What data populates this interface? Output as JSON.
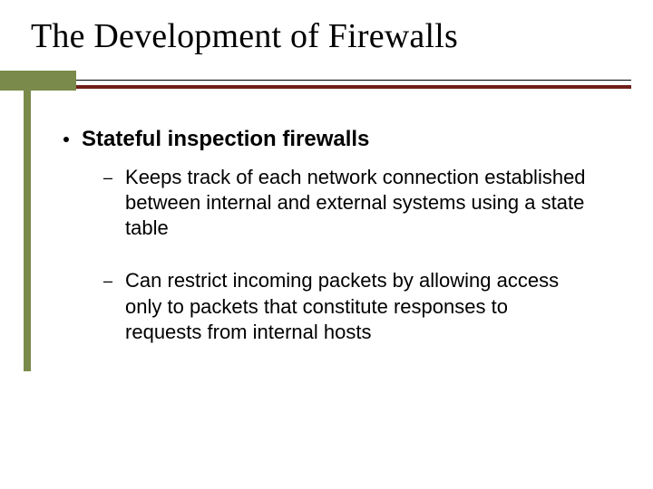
{
  "title": "The Development of Firewalls",
  "bullets": {
    "level1": {
      "text": "Stateful inspection firewalls"
    },
    "sub": [
      {
        "text": "Keeps track of each network connection established between internal and external systems using a state table"
      },
      {
        "text": "Can restrict incoming packets by allowing access only to packets that constitute responses to requests from internal hosts"
      }
    ]
  }
}
